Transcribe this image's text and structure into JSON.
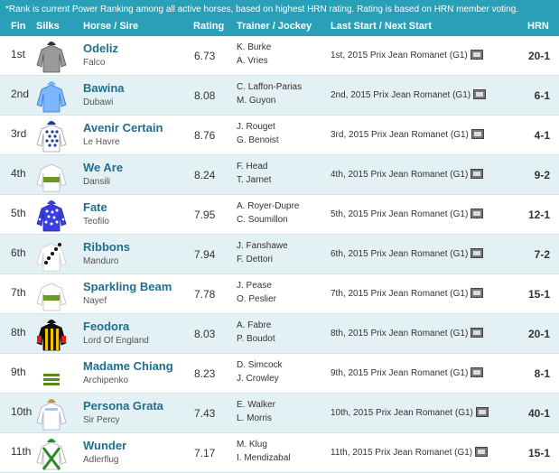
{
  "note": "*Rank is current Power Ranking among all active horses, based on highest HRN rating. Rating is based on HRN member voting.",
  "columns": {
    "fin": "Fin",
    "silks": "Silks",
    "horse": "Horse / Sire",
    "rating": "Rating",
    "trainer_jockey": "Trainer / Jockey",
    "last_start": "Last Start / Next Start",
    "hrn": "HRN"
  },
  "rows": [
    {
      "fin": "1st",
      "name": "Odeliz",
      "sire": "Falco",
      "rating": "6.73",
      "trainer": "K. Burke",
      "jockey": "A. Vries",
      "last_start": "1st, 2015 Prix Jean Romanet (G1)",
      "odds": "20-1",
      "silk": "gray"
    },
    {
      "fin": "2nd",
      "name": "Bawina",
      "sire": "Dubawi",
      "rating": "8.08",
      "trainer": "C. Laffon-Parias",
      "jockey": "M. Guyon",
      "last_start": "2nd, 2015 Prix Jean Romanet (G1)",
      "odds": "6-1",
      "silk": "lightblue"
    },
    {
      "fin": "3rd",
      "name": "Avenir Certain",
      "sire": "Le Havre",
      "rating": "8.76",
      "trainer": "J. Rouget",
      "jockey": "G. Benoist",
      "last_start": "3rd, 2015 Prix Jean Romanet (G1)",
      "odds": "4-1",
      "silk": "bluedots"
    },
    {
      "fin": "4th",
      "name": "We Are",
      "sire": "Dansili",
      "rating": "8.24",
      "trainer": "F. Head",
      "jockey": "T. Jarnet",
      "last_start": "4th, 2015 Prix Jean Romanet (G1)",
      "odds": "9-2",
      "silk": "whitegreen"
    },
    {
      "fin": "5th",
      "name": "Fate",
      "sire": "Teofilo",
      "rating": "7.95",
      "trainer": "A. Royer-Dupre",
      "jockey": "C. Soumillon",
      "last_start": "5th, 2015 Prix Jean Romanet (G1)",
      "odds": "12-1",
      "silk": "bluewhitedots"
    },
    {
      "fin": "6th",
      "name": "Ribbons",
      "sire": "Manduro",
      "rating": "7.94",
      "trainer": "J. Fanshawe",
      "jockey": "F. Dettori",
      "last_start": "6th, 2015 Prix Jean Romanet (G1)",
      "odds": "7-2",
      "silk": "whiteblackdots"
    },
    {
      "fin": "7th",
      "name": "Sparkling Beam",
      "sire": "Nayef",
      "rating": "7.78",
      "trainer": "J. Pease",
      "jockey": "O. Peslier",
      "last_start": "7th, 2015 Prix Jean Romanet (G1)",
      "odds": "15-1",
      "silk": "whitegreen2"
    },
    {
      "fin": "8th",
      "name": "Feodora",
      "sire": "Lord Of England",
      "rating": "8.03",
      "trainer": "A. Fabre",
      "jockey": "P. Boudot",
      "last_start": "8th, 2015 Prix Jean Romanet (G1)",
      "odds": "20-1",
      "silk": "blackyellow"
    },
    {
      "fin": "9th",
      "name": "Madame Chiang",
      "sire": "Archipenko",
      "rating": "8.23",
      "trainer": "D. Simcock",
      "jockey": "J. Crowley",
      "last_start": "9th, 2015 Prix Jean Romanet (G1)",
      "odds": "8-1",
      "silk": "greenbars"
    },
    {
      "fin": "10th",
      "name": "Persona Grata",
      "sire": "Sir Percy",
      "rating": "7.43",
      "trainer": "E. Walker",
      "jockey": "L. Morris",
      "last_start": "10th, 2015 Prix Jean Romanet (G1)",
      "odds": "40-1",
      "silk": "lightbluecap"
    },
    {
      "fin": "11th",
      "name": "Wunder",
      "sire": "Adlerflug",
      "rating": "7.17",
      "trainer": "M. Klug",
      "jockey": "I. Mendizabal",
      "last_start": "11th, 2015 Prix Jean Romanet (G1)",
      "odds": "15-1",
      "silk": "whitegreencross"
    }
  ],
  "colors": {
    "header_bg": "#2aa0b8",
    "row_alt_bg": "#e3f0f4",
    "horse_name": "#1e6f8e"
  }
}
